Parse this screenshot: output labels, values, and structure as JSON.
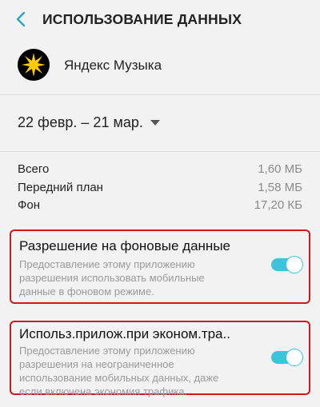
{
  "header": {
    "title": "ИСПОЛЬЗОВАНИЕ ДАННЫХ",
    "back_icon": "chevron-left-icon",
    "accent": "#2fa5c4"
  },
  "app": {
    "name": "Яндекс Музыка",
    "icon": "yandex-music-logo"
  },
  "period": {
    "selected": "22 февр. – 21 мар."
  },
  "usage": [
    {
      "label": "Всего",
      "value": "1,60 МБ"
    },
    {
      "label": "Передний план",
      "value": "1,58 МБ"
    },
    {
      "label": "Фон",
      "value": "17,20 КБ"
    }
  ],
  "settings": [
    {
      "title": "Разрешение на фоновые данные",
      "description": "Предоставление этому приложению разрешения использовать мобильные данные в фоновом режиме.",
      "enabled": true
    },
    {
      "title": "Использ.прилож.при эконом.тра..",
      "description": "Предоставление этому приложению разрешения на неограниченное использование мобильных данных, даже если включена экономия трафика.",
      "enabled": true
    }
  ],
  "colors": {
    "toggle_on": "#3cc4dd",
    "highlight_border": "#d0171f"
  }
}
